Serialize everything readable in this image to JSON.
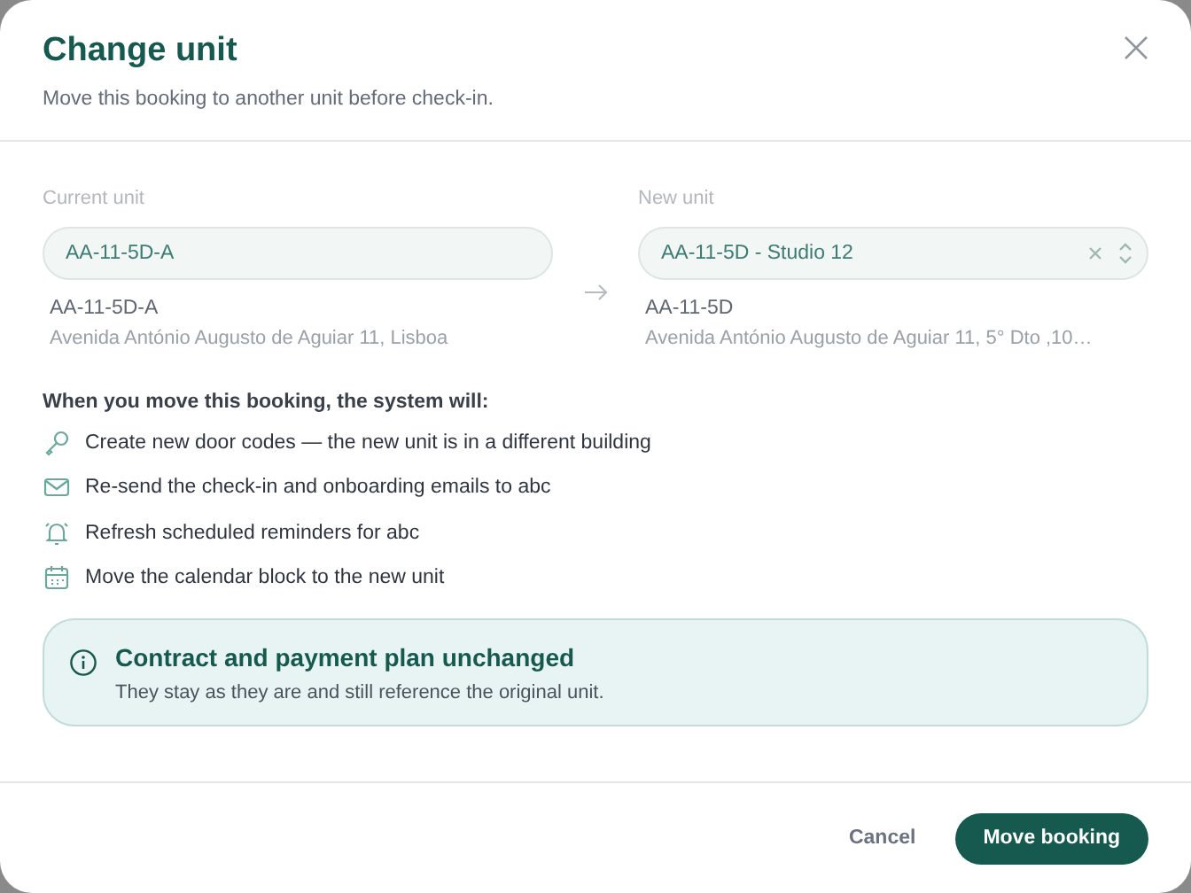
{
  "dialog": {
    "title": "Change unit",
    "subtitle": "Move this booking to another unit before check-in."
  },
  "current_unit": {
    "label": "Current unit",
    "value": "AA-11-5D-A",
    "code": "AA-11-5D-A",
    "address": "Avenida António Augusto de Aguiar 11, Lisboa"
  },
  "new_unit": {
    "label": "New unit",
    "value": "AA-11-5D - Studio 12",
    "code": "AA-11-5D",
    "address": "Avenida António Augusto de Aguiar 11, 5° Dto ,10…"
  },
  "changes": {
    "heading": "When you move this booking, the system will:",
    "items": [
      {
        "kind": "key",
        "text": "Create new door codes — the new unit is in a different building"
      },
      {
        "kind": "mail",
        "text": "Re-send the check-in and onboarding emails to abc"
      },
      {
        "kind": "bell",
        "text": "Refresh scheduled reminders for abc"
      },
      {
        "kind": "calendar",
        "text": "Move the calendar block to the new unit"
      }
    ]
  },
  "note": {
    "title": "Contract and payment plan unchanged",
    "text": "They stay as they are and still reference the original unit."
  },
  "buttons": [
    {
      "kind": "secondary",
      "label": "Cancel"
    },
    {
      "kind": "primary",
      "label": "Move booking"
    }
  ]
}
